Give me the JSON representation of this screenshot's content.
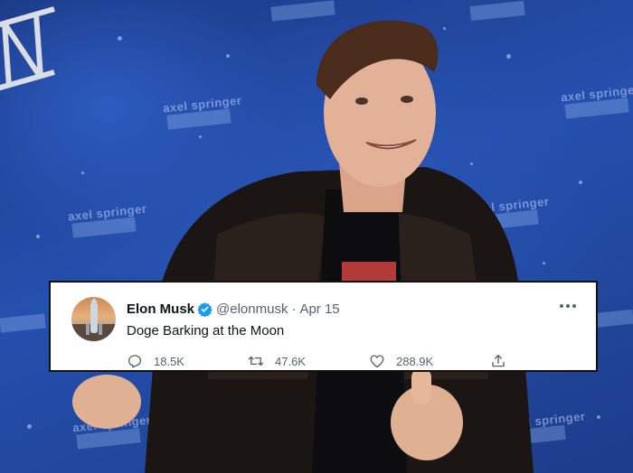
{
  "tweet": {
    "display_name": "Elon Musk",
    "handle": "@elonmusk",
    "separator": "·",
    "date": "Apr 15",
    "text": "Doge Barking at the Moon",
    "replies": "18.5K",
    "retweets": "47.6K",
    "likes": "288.9K"
  },
  "background": {
    "banner_text": "axel springer"
  },
  "colors": {
    "background_blue": "#2550ae",
    "verified_blue": "#1d9bf0",
    "text_primary": "#0f1419",
    "text_secondary": "#536471",
    "card_border": "#111111"
  },
  "icons": [
    "verified-badge-icon",
    "more-options-icon",
    "reply-icon",
    "retweet-icon",
    "like-icon",
    "share-icon"
  ]
}
